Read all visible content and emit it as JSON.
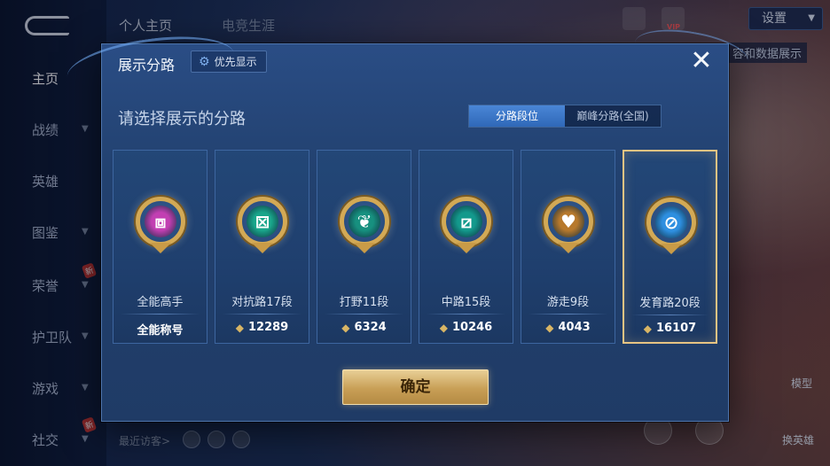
{
  "background": {
    "top_tabs": [
      "个人主页",
      "电竞生涯"
    ],
    "nav_items": [
      {
        "label": "主页",
        "active": true,
        "chevron": false,
        "new": false
      },
      {
        "label": "战绩",
        "active": false,
        "chevron": true,
        "new": false
      },
      {
        "label": "英雄",
        "active": false,
        "chevron": false,
        "new": false
      },
      {
        "label": "图鉴",
        "active": false,
        "chevron": true,
        "new": false
      },
      {
        "label": "荣誉",
        "active": false,
        "chevron": true,
        "new": true
      },
      {
        "label": "护卫队",
        "active": false,
        "chevron": true,
        "new": false
      },
      {
        "label": "游戏",
        "active": false,
        "chevron": true,
        "new": false
      },
      {
        "label": "社交",
        "active": false,
        "chevron": true,
        "new": true
      }
    ],
    "new_badge": "新",
    "vip_tag": "VIP",
    "settings_label": "设置",
    "peek_text": "容和数据展示",
    "recent_visitors": "最近访客>",
    "model_label": "模型",
    "switch_hero_label": "换英雄"
  },
  "modal": {
    "title": "展示分路",
    "priority_label": "优先显示",
    "close_label": "✕",
    "subtitle": "请选择展示的分路",
    "segments": [
      {
        "label": "分路段位",
        "active": true
      },
      {
        "label": "巅峰分路(全国)",
        "active": false
      }
    ],
    "cards": [
      {
        "name": "全能高手",
        "footer": "全能称号",
        "has_points": false,
        "icon": "all-round-icon",
        "color": "#c23fb2",
        "glyph": "⧈",
        "selected": false
      },
      {
        "name": "对抗路17段",
        "footer": "12289",
        "has_points": true,
        "icon": "clash-lane-icon",
        "color": "#19a58a",
        "glyph": "⊠",
        "selected": false
      },
      {
        "name": "打野11段",
        "footer": "6324",
        "has_points": true,
        "icon": "jungle-icon",
        "color": "#17907f",
        "glyph": "❦",
        "selected": false
      },
      {
        "name": "中路15段",
        "footer": "10246",
        "has_points": true,
        "icon": "mid-lane-icon",
        "color": "#13998c",
        "glyph": "⧄",
        "selected": false
      },
      {
        "name": "游走9段",
        "footer": "4043",
        "has_points": true,
        "icon": "roam-icon",
        "color": "#b7792c",
        "glyph": "♥",
        "selected": false
      },
      {
        "name": "发育路20段",
        "footer": "16107",
        "has_points": true,
        "icon": "farm-lane-icon",
        "color": "#2e8fe0",
        "glyph": "⊘",
        "selected": true
      }
    ],
    "confirm_label": "确定"
  }
}
